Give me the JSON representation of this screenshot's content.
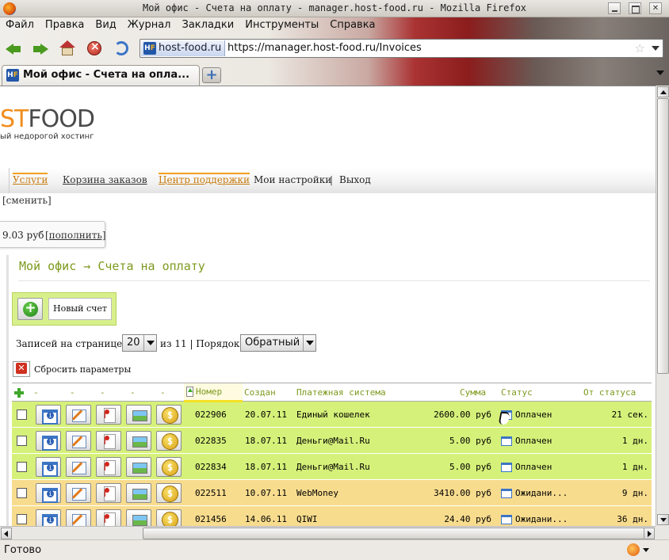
{
  "window": {
    "title": "Мой офис - Счета на оплату - manager.host-food.ru - Mozilla Firefox"
  },
  "menu": [
    "Файл",
    "Правка",
    "Вид",
    "Журнал",
    "Закладки",
    "Инструменты",
    "Справка"
  ],
  "urlbar": {
    "site_id": "host-food.ru",
    "url": "https://manager.host-food.ru/Invoices"
  },
  "tab": {
    "title": "Мой офис - Счета на опла...",
    "new_tab_symbol": "+"
  },
  "favicon": {
    "h": "H",
    "f": "F"
  },
  "logo": {
    "brand_orange": "ST",
    "brand_grey": "FOOD",
    "slogan": "ый недорогой хостинг"
  },
  "topnav": {
    "services": "Услуги",
    "cart": "Корзина заказов",
    "support": "Центр поддержки",
    "settings": "Мои настройки",
    "separator": "|",
    "exit": "Выход"
  },
  "account": {
    "change_link": "[сменить]",
    "balance": "9.03 руб",
    "topup_link": "[пополнить]"
  },
  "page": {
    "title": "Мой офис → Счета на оплату",
    "new_invoice": "Новый счет"
  },
  "filters": {
    "per_page_label": "Записей на странице:",
    "per_page_value": "20",
    "pages_text": "из 11 | Порядок:",
    "order_value": "Обратный",
    "reset_label": "Сбросить параметры"
  },
  "table": {
    "columns": {
      "dash1": "-",
      "dash2": "-",
      "dash3": "-",
      "dash4": "-",
      "dash5": "-",
      "number": "Номер",
      "created": "Создан",
      "payment_system": "Платежная система",
      "amount": "Сумма",
      "status": "Статус",
      "since_status": "От статуса"
    },
    "rows": [
      {
        "number": "022906",
        "created": "20.07.11",
        "system": "Единый кошелек",
        "amount": "2600.00 руб",
        "status": "Оплачен",
        "since": "21 сек.",
        "state": "paid"
      },
      {
        "number": "022835",
        "created": "18.07.11",
        "system": "Деньги@Mail.Ru",
        "amount": "5.00 руб",
        "status": "Оплачен",
        "since": "1 дн.",
        "state": "paid"
      },
      {
        "number": "022834",
        "created": "18.07.11",
        "system": "Деньги@Mail.Ru",
        "amount": "5.00 руб",
        "status": "Оплачен",
        "since": "1 дн.",
        "state": "paid"
      },
      {
        "number": "022511",
        "created": "10.07.11",
        "system": "WebMoney",
        "amount": "3410.00 руб",
        "status": "Ожидани...",
        "since": "9 дн.",
        "state": "pending"
      },
      {
        "number": "021456",
        "created": "14.06.11",
        "system": "QIWI",
        "amount": "24.40 руб",
        "status": "Ожидани...",
        "since": "36 дн.",
        "state": "pending"
      }
    ]
  },
  "statusbar": {
    "text": "Готово"
  },
  "colors": {
    "paid_row": "#d6f17a",
    "pending_row": "#f8dc8e",
    "accent_green": "#7d9a1e",
    "accent_orange": "#f08e1d"
  }
}
